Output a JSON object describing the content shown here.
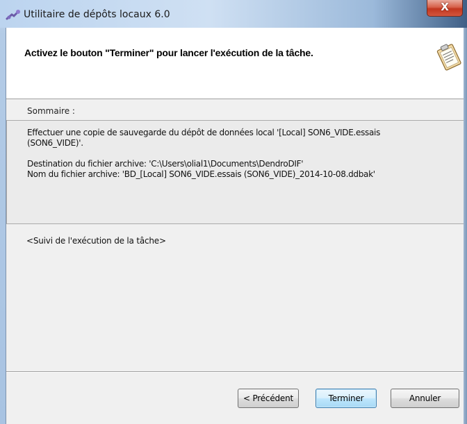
{
  "window": {
    "title": "Utilitaire de dépôts locaux 6.0",
    "close_label": "X"
  },
  "header": {
    "instruction": "Activez le bouton \"Terminer\" pour lancer l'exécution de la tâche."
  },
  "summary": {
    "label": "Sommaire :",
    "line1": "Effectuer une copie de sauvegarde du dépôt de données local '[Local] SON6_VIDE.essais",
    "line2": "(SON6_VIDE)'.",
    "destination": "Destination du fichier archive: 'C:\\Users\\olial1\\Documents\\DendroDIF'",
    "filename": "Nom du fichier archive: 'BD_[Local] SON6_VIDE.essais (SON6_VIDE)_2014-10-08.ddbak'"
  },
  "progress": {
    "text": "<Suivi de l'exécution de la tâche>"
  },
  "buttons": {
    "previous": "< Précédent",
    "finish": "Terminer",
    "cancel": "Annuler"
  },
  "icons": {
    "app": "puzzle-gear-icon",
    "header": "clipboard-icon"
  }
}
